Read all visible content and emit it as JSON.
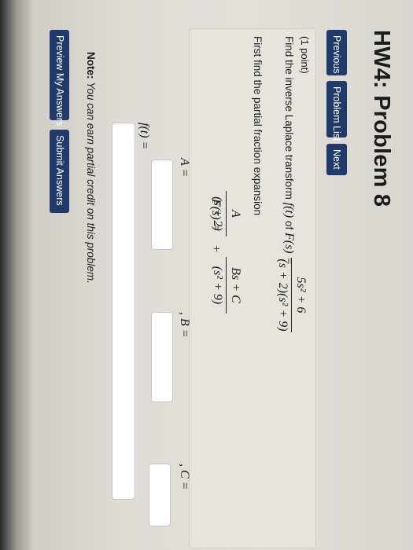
{
  "header": {
    "title": "HW4: Problem 8"
  },
  "nav": {
    "previous": "Previous",
    "problem_list": "Problem List",
    "next": "Next"
  },
  "problem": {
    "points": "(1 point)",
    "question_text": "Find the inverse Laplace transform",
    "question_f": "f(t)",
    "question_of": "of",
    "question_F": "F(s) =",
    "F_numerator": "5s² + 6",
    "F_denominator": "(s + 2)(s² + 9)",
    "instruction": "First find the partial fraction expansion",
    "lhs": "F(s) =",
    "A_num": "A",
    "A_den": "(s + 2)",
    "plus": "+",
    "B_num": "Bs + C",
    "B_den": "(s² + 9)",
    "A_label": "A =",
    "B_label": ", B =",
    "C_label": ", C =",
    "f_label": "f(t) =",
    "A_value": "",
    "B_value": "",
    "C_value": "",
    "f_value": ""
  },
  "note": {
    "label": "Note:",
    "text": "You can earn partial credit on this problem."
  },
  "actions": {
    "preview": "Preview My Answers",
    "submit": "Submit Answers"
  }
}
